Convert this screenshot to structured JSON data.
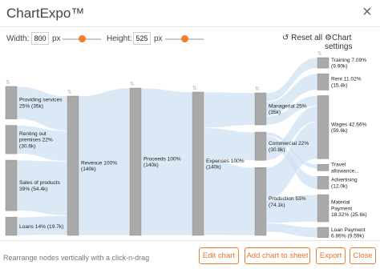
{
  "window": {
    "title": "ChartExpo™"
  },
  "controls": {
    "width_label": "Width:",
    "width_value": "800",
    "height_label": "Height:",
    "height_value": "525",
    "unit": "px",
    "width_slider_level": 0.5,
    "height_slider_level": 0.5,
    "reset_label": "Reset all",
    "settings_label": "Chart settings"
  },
  "accent_color": "#f07c2a",
  "chart_data": {
    "type": "sankey",
    "nodes": [
      {
        "id": "providing",
        "label": [
          "Providing services",
          "25% (35k)"
        ]
      },
      {
        "id": "renting",
        "label": [
          "Renting out",
          "premises 22%",
          "(30.6k)"
        ]
      },
      {
        "id": "sales",
        "label": [
          "Sales of products",
          "39% (54.4k)"
        ]
      },
      {
        "id": "loans",
        "label": [
          "Loans 14% (19.7k)"
        ]
      },
      {
        "id": "revenue",
        "label": [
          "Revenue 100%",
          "(140k)"
        ]
      },
      {
        "id": "proceeds",
        "label": [
          "Proceeds 100%",
          "(140k)"
        ]
      },
      {
        "id": "expenses",
        "label": [
          "Expenses 100%",
          "(140k)"
        ]
      },
      {
        "id": "managerial",
        "label": [
          "Managerial 25%",
          "(35k)"
        ]
      },
      {
        "id": "commercial",
        "label": [
          "Commercial 22%",
          "(30.8k)"
        ]
      },
      {
        "id": "production",
        "label": [
          "Production 53%",
          "(74.1k)"
        ]
      },
      {
        "id": "training",
        "label": [
          "Training 7.09%",
          "(9.90k)"
        ]
      },
      {
        "id": "rent",
        "label": [
          "Rent 11.02%",
          "(15.4k)"
        ]
      },
      {
        "id": "wages",
        "label": [
          "Wages 42.66%",
          "(59.6k)"
        ]
      },
      {
        "id": "travel",
        "label": [
          "Travel",
          "allowance..."
        ]
      },
      {
        "id": "advertising",
        "label": [
          "Advertising",
          "(12.0k)"
        ]
      },
      {
        "id": "material",
        "label": [
          "Material",
          "Payment",
          "18.32% (25.6k)"
        ]
      },
      {
        "id": "loanpay",
        "label": [
          "Loan Payment",
          "6.86% (9.59k)"
        ]
      }
    ],
    "links": [
      {
        "source": "providing",
        "target": "revenue",
        "value": 35
      },
      {
        "source": "renting",
        "target": "revenue",
        "value": 30.6
      },
      {
        "source": "sales",
        "target": "revenue",
        "value": 54.4
      },
      {
        "source": "loans",
        "target": "revenue",
        "value": 19.7
      },
      {
        "source": "revenue",
        "target": "proceeds",
        "value": 140
      },
      {
        "source": "proceeds",
        "target": "expenses",
        "value": 140
      },
      {
        "source": "expenses",
        "target": "managerial",
        "value": 35
      },
      {
        "source": "expenses",
        "target": "commercial",
        "value": 30.8
      },
      {
        "source": "expenses",
        "target": "production",
        "value": 74.1
      },
      {
        "source": "managerial",
        "target": "training",
        "value": 9.9
      },
      {
        "source": "managerial",
        "target": "rent",
        "value": 15.4
      },
      {
        "source": "managerial",
        "target": "wages",
        "value": 9.7
      },
      {
        "source": "commercial",
        "target": "travel",
        "value": 4
      },
      {
        "source": "commercial",
        "target": "advertising",
        "value": 12
      },
      {
        "source": "commercial",
        "target": "wages",
        "value": 14.8
      },
      {
        "source": "production",
        "target": "wages",
        "value": 35.1
      },
      {
        "source": "production",
        "target": "material",
        "value": 25.6
      },
      {
        "source": "production",
        "target": "loanpay",
        "value": 9.59
      }
    ]
  },
  "footer": {
    "hint": "Rearrange nodes vertically with a click-n-drag",
    "buttons": {
      "edit": "Edit chart",
      "add": "Add chart to sheet",
      "export": "Export",
      "close": "Close"
    }
  }
}
